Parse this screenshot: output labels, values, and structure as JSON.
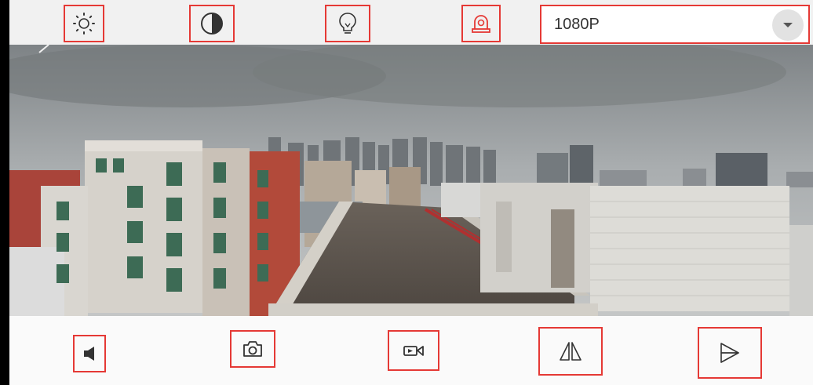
{
  "top_bar": {
    "resolution": {
      "value": "1080P",
      "icon": "chevron-down-icon"
    },
    "controls": [
      {
        "name": "brightness",
        "icon": "sun-icon"
      },
      {
        "name": "contrast",
        "icon": "contrast-icon"
      },
      {
        "name": "light",
        "icon": "lightbulb-icon"
      },
      {
        "name": "alarm",
        "icon": "siren-icon",
        "color": "#e53935"
      }
    ]
  },
  "bottom_bar": {
    "controls": [
      {
        "name": "mute",
        "icon": "speaker-icon"
      },
      {
        "name": "snapshot",
        "icon": "camera-icon"
      },
      {
        "name": "record",
        "icon": "video-record-icon"
      },
      {
        "name": "flip",
        "icon": "flip-icon"
      },
      {
        "name": "mirror",
        "icon": "mirror-icon"
      }
    ]
  },
  "colors": {
    "highlight": "#e53935",
    "top_bar_bg": "#f1f1f1",
    "icon": "#333333"
  }
}
